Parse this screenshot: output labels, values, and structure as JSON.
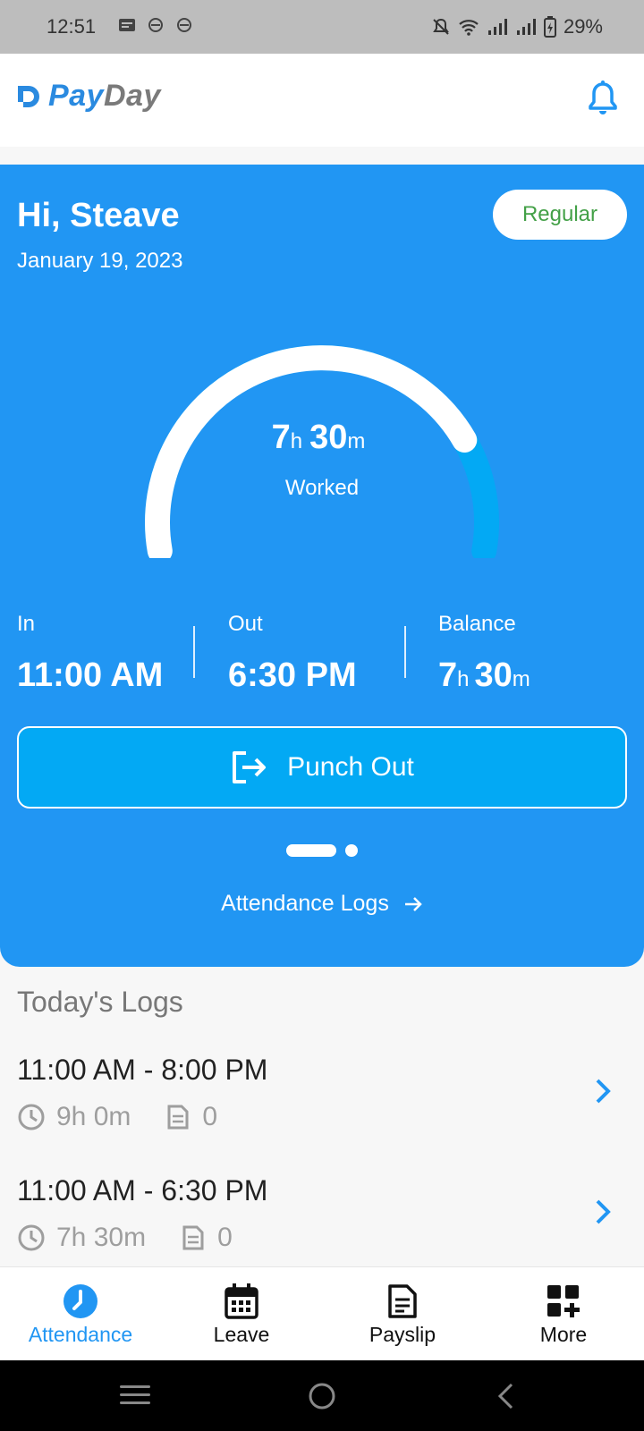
{
  "status_bar": {
    "time": "12:51",
    "battery": "29%"
  },
  "header": {
    "brand_first": "Pay",
    "brand_second": "Day"
  },
  "hero": {
    "greeting": "Hi, Steave",
    "date": "January 19, 2023",
    "shift_badge": "Regular",
    "gauge": {
      "hours": "7",
      "hours_unit": "h",
      "minutes": "30",
      "minutes_unit": "m",
      "label": "Worked",
      "progress": 0.8
    },
    "stats": {
      "in": {
        "label": "In",
        "value": "11:00 AM"
      },
      "out": {
        "label": "Out",
        "value": "6:30 PM"
      },
      "balance": {
        "label": "Balance",
        "hours": "7",
        "hours_unit": "h",
        "minutes": "30",
        "minutes_unit": "m"
      }
    },
    "punch_button": "Punch Out",
    "logs_link": "Attendance Logs"
  },
  "todays_logs": {
    "title": "Today's Logs",
    "items": [
      {
        "range": "11:00 AM - 8:00 PM",
        "duration": "9h 0m",
        "notes": "0"
      },
      {
        "range": "11:00 AM - 6:30 PM",
        "duration": "7h 30m",
        "notes": "0"
      }
    ]
  },
  "bottom_nav": [
    {
      "label": "Attendance",
      "icon": "clock-icon",
      "active": true
    },
    {
      "label": "Leave",
      "icon": "calendar-icon",
      "active": false
    },
    {
      "label": "Payslip",
      "icon": "document-icon",
      "active": false
    },
    {
      "label": "More",
      "icon": "grid-plus-icon",
      "active": false
    }
  ],
  "colors": {
    "primary": "#2196F3",
    "accent": "#03A9F4",
    "badge_text": "#43A047"
  }
}
